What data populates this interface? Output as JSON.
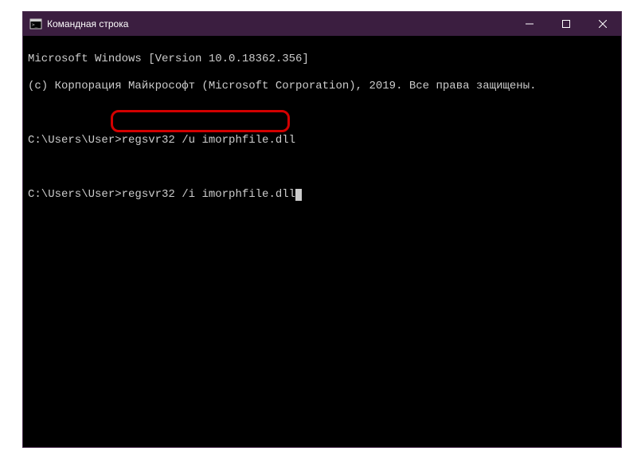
{
  "window": {
    "title": "Командная строка"
  },
  "terminal": {
    "line1": "Microsoft Windows [Version 10.0.18362.356]",
    "line2": "(c) Корпорация Майкрософт (Microsoft Corporation), 2019. Все права защищены.",
    "prompt1": "C:\\Users\\User>",
    "cmd1": "regsvr32 /u imorphfile.dll",
    "prompt2": "C:\\Users\\User>",
    "cmd2": "regsvr32 /i imorphfile.dll"
  }
}
